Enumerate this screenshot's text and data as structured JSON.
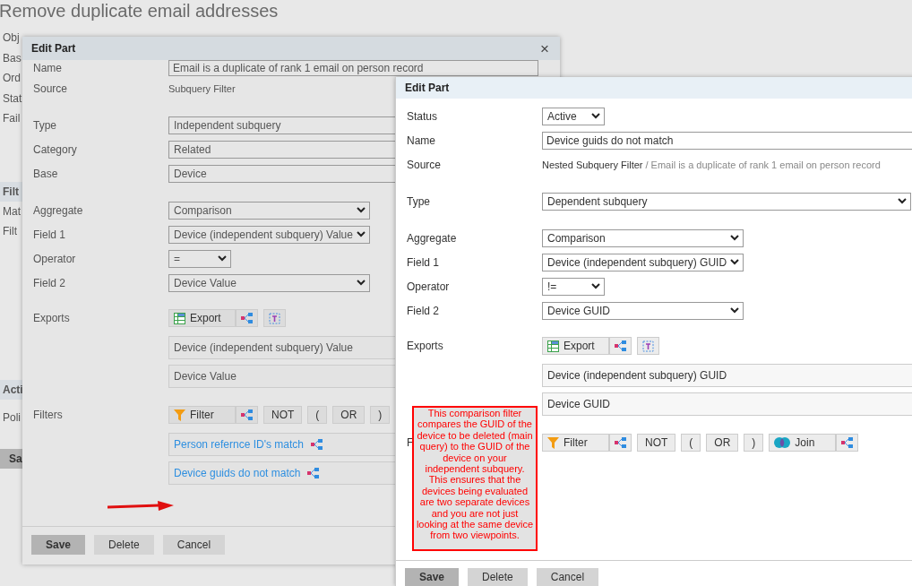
{
  "background": {
    "title": "Remove duplicate email addresses",
    "items": [
      {
        "kind": "label",
        "text": "Obj"
      },
      {
        "kind": "label",
        "text": "Bas"
      },
      {
        "kind": "label",
        "text": "Ord"
      },
      {
        "kind": "label",
        "text": "Stat"
      },
      {
        "kind": "label",
        "text": "Fail"
      },
      {
        "kind": "section",
        "text": "Filt"
      },
      {
        "kind": "label",
        "text": "Mat"
      },
      {
        "kind": "label",
        "text": "Filt"
      },
      {
        "kind": "section",
        "text": "Acti"
      },
      {
        "kind": "label",
        "text": "Poli"
      },
      {
        "kind": "button",
        "text": "Sa"
      }
    ]
  },
  "dialogs": [
    {
      "title": "Edit Part",
      "dimmed": true,
      "close": "×",
      "rows": [
        {
          "kind": "input",
          "label": "Name",
          "value": "Email is a duplicate of rank 1 email on person record"
        },
        {
          "kind": "static",
          "label": "Source",
          "value": "Subquery Filter"
        },
        {
          "kind": "wide-select",
          "label": "Type",
          "value": "Independent subquery",
          "spaced": true
        },
        {
          "kind": "wide-select",
          "label": "Category",
          "value": "Related"
        },
        {
          "kind": "wide-select",
          "label": "Base",
          "value": "Device"
        },
        {
          "kind": "select",
          "label": "Aggregate",
          "value": "Comparison",
          "spaced": true
        },
        {
          "kind": "select",
          "label": "Field 1",
          "value": "Device (independent subquery) Value"
        },
        {
          "kind": "short-select",
          "label": "Operator",
          "value": "="
        },
        {
          "kind": "select",
          "label": "Field 2",
          "value": "Device Value"
        },
        {
          "kind": "toolbar",
          "label": "Exports",
          "spaced": true,
          "tools": [
            {
              "kind": "export",
              "text": "Export"
            },
            {
              "kind": "tree"
            },
            {
              "kind": "text-tool"
            }
          ]
        },
        {
          "kind": "list",
          "items": [
            {
              "kind": "value",
              "text": "Device (independent subquery) Value"
            },
            {
              "kind": "value",
              "text": "Device Value"
            }
          ]
        },
        {
          "kind": "toolbar",
          "label": "Filters",
          "spaced": true,
          "tools": [
            {
              "kind": "filter",
              "text": "Filter"
            },
            {
              "kind": "tree"
            },
            {
              "kind": "plain",
              "text": "NOT"
            },
            {
              "kind": "plain",
              "text": "("
            },
            {
              "kind": "plain",
              "text": "OR"
            },
            {
              "kind": "plain",
              "text": ")"
            }
          ]
        },
        {
          "kind": "list",
          "items": [
            {
              "kind": "link",
              "text": "Person refernce ID's match"
            },
            {
              "kind": "link",
              "text": "Device guids do not match"
            }
          ]
        }
      ],
      "buttons": [
        {
          "text": "Save",
          "primary": true
        },
        {
          "text": "Delete",
          "primary": false
        },
        {
          "text": "Cancel",
          "primary": false
        }
      ]
    },
    {
      "title": "Edit Part",
      "dimmed": false,
      "rows": [
        {
          "kind": "short-select",
          "label": "Status",
          "value": "Active"
        },
        {
          "kind": "input",
          "label": "Name",
          "value": "Device guids do not match"
        },
        {
          "kind": "static",
          "label": "Source",
          "value": "Nested Subquery Filter",
          "trail": "/ Email is a duplicate of rank 1 email on person record"
        },
        {
          "kind": "wide-select",
          "label": "Type",
          "value": "Dependent subquery",
          "spaced": true
        },
        {
          "kind": "select",
          "label": "Aggregate",
          "value": "Comparison",
          "spaced": true
        },
        {
          "kind": "select",
          "label": "Field 1",
          "value": "Device (independent subquery) GUID"
        },
        {
          "kind": "short-select",
          "label": "Operator",
          "value": "!="
        },
        {
          "kind": "select",
          "label": "Field 2",
          "value": "Device GUID"
        },
        {
          "kind": "toolbar",
          "label": "Exports",
          "spaced": true,
          "tools": [
            {
              "kind": "export",
              "text": "Export"
            },
            {
              "kind": "tree"
            },
            {
              "kind": "text-tool"
            }
          ]
        },
        {
          "kind": "list",
          "items": [
            {
              "kind": "value",
              "text": "Device (independent subquery) GUID"
            },
            {
              "kind": "value",
              "text": "Device GUID"
            }
          ]
        },
        {
          "kind": "toolbar",
          "label": "F",
          "spaced": true,
          "tools": [
            {
              "kind": "filter",
              "text": "Filter"
            },
            {
              "kind": "tree"
            },
            {
              "kind": "plain",
              "text": "NOT"
            },
            {
              "kind": "plain",
              "text": "("
            },
            {
              "kind": "plain",
              "text": "OR"
            },
            {
              "kind": "plain",
              "text": ")"
            },
            {
              "kind": "join",
              "text": "Join"
            },
            {
              "kind": "tree"
            }
          ]
        }
      ],
      "buttons": [
        {
          "text": "Save",
          "primary": true
        },
        {
          "text": "Delete",
          "primary": false
        },
        {
          "text": "Cancel",
          "primary": false
        }
      ]
    }
  ],
  "annotation": {
    "note": "This comparison filter compares the GUID of the device to be deleted (main query) to the GUID of the device on your independent subquery. This ensures that the devices being evaluated are two separate devices and you are not just looking at the same device from two viewpoints."
  }
}
